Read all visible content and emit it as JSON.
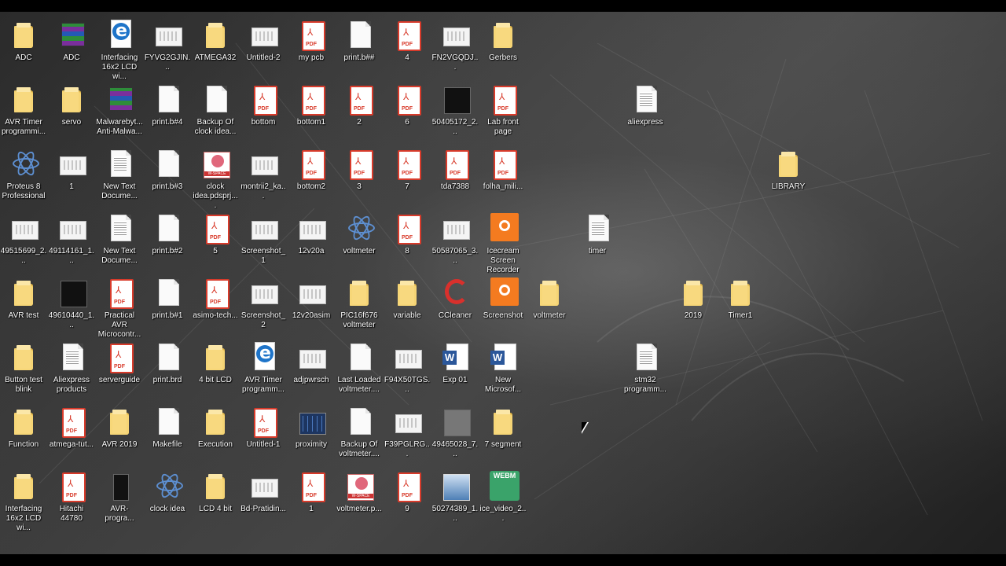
{
  "window": {
    "title": "Desktop"
  },
  "icons": [
    {
      "label": "ADC",
      "type": "folder"
    },
    {
      "label": "ADC",
      "type": "winrar"
    },
    {
      "label": "Interfacing 16x2 LCD wi...",
      "type": "edge"
    },
    {
      "label": "FYVG2GJIN...",
      "type": "image"
    },
    {
      "label": "ATMEGA32",
      "type": "folder"
    },
    {
      "label": "Untitled-2",
      "type": "image"
    },
    {
      "label": "my pcb",
      "type": "pdf"
    },
    {
      "label": "print.b##",
      "type": "document"
    },
    {
      "label": "4",
      "type": "pdf"
    },
    {
      "label": "FN2VGQDJ...",
      "type": "image"
    },
    {
      "label": "Gerbers",
      "type": "folder"
    },
    {
      "label": "AVR Timer programmi...",
      "type": "folder"
    },
    {
      "label": "servo",
      "type": "folder"
    },
    {
      "label": "Malwarebyt... Anti-Malwa...",
      "type": "winrar"
    },
    {
      "label": "print.b#4",
      "type": "document"
    },
    {
      "label": "Backup Of clock idea...",
      "type": "document"
    },
    {
      "label": "bottom",
      "type": "pdf"
    },
    {
      "label": "bottom1",
      "type": "pdf"
    },
    {
      "label": "2",
      "type": "pdf"
    },
    {
      "label": "6",
      "type": "pdf"
    },
    {
      "label": "50405172_2...",
      "type": "dark"
    },
    {
      "label": "Lab front page",
      "type": "pdf"
    },
    {
      "label": "aliexpress",
      "type": "text"
    },
    {
      "label": "Proteus 8 Professional",
      "type": "proteus"
    },
    {
      "label": "1",
      "type": "image"
    },
    {
      "label": "New Text Docume...",
      "type": "text"
    },
    {
      "label": "print.b#3",
      "type": "document"
    },
    {
      "label": "clock idea.pdsprj....",
      "type": "wspace"
    },
    {
      "label": "montrii2_ka...",
      "type": "image"
    },
    {
      "label": "bottom2",
      "type": "pdf"
    },
    {
      "label": "3",
      "type": "pdf"
    },
    {
      "label": "7",
      "type": "pdf"
    },
    {
      "label": "tda7388",
      "type": "pdf"
    },
    {
      "label": "folha_mili...",
      "type": "pdf"
    },
    {
      "label": "LIBRARY",
      "type": "folder"
    },
    {
      "label": "49515699_2...",
      "type": "image"
    },
    {
      "label": "49114161_1...",
      "type": "image"
    },
    {
      "label": "New Text Docume...",
      "type": "text"
    },
    {
      "label": "print.b#2",
      "type": "document"
    },
    {
      "label": "5",
      "type": "pdf"
    },
    {
      "label": "Screenshot_1",
      "type": "image"
    },
    {
      "label": "12v20a",
      "type": "image"
    },
    {
      "label": "voltmeter",
      "type": "proteus"
    },
    {
      "label": "8",
      "type": "pdf"
    },
    {
      "label": "50587065_3...",
      "type": "image"
    },
    {
      "label": "Icecream Screen Recorder",
      "type": "orange"
    },
    {
      "label": "timer",
      "type": "text"
    },
    {
      "label": "AVR test",
      "type": "folder"
    },
    {
      "label": "49610440_1...",
      "type": "dark"
    },
    {
      "label": "Practical AVR Microcontr...",
      "type": "pdf"
    },
    {
      "label": "print.b#1",
      "type": "document"
    },
    {
      "label": "asimo-tech...",
      "type": "pdf"
    },
    {
      "label": "Screenshot_2",
      "type": "image"
    },
    {
      "label": "12v20asim",
      "type": "image"
    },
    {
      "label": "PIC16f676 voltmeter",
      "type": "folder"
    },
    {
      "label": "variable",
      "type": "folder"
    },
    {
      "label": "CCleaner",
      "type": "ccleaner"
    },
    {
      "label": "Screenshot",
      "type": "orange"
    },
    {
      "label": "voltmeter",
      "type": "folder"
    },
    {
      "label": "2019",
      "type": "folder"
    },
    {
      "label": "Timer1",
      "type": "folder"
    },
    {
      "label": "Button test blink",
      "type": "folder"
    },
    {
      "label": "Aliexpress products",
      "type": "text"
    },
    {
      "label": "serverguide",
      "type": "pdf"
    },
    {
      "label": "print.brd",
      "type": "document"
    },
    {
      "label": "4 bit LCD",
      "type": "folder"
    },
    {
      "label": "AVR Timer programm...",
      "type": "edge"
    },
    {
      "label": "adjpwrsch",
      "type": "image"
    },
    {
      "label": "Last Loaded voltmeter....",
      "type": "document"
    },
    {
      "label": "F94X50TGS...",
      "type": "image"
    },
    {
      "label": "Exp 01",
      "type": "word"
    },
    {
      "label": "New Microsof...",
      "type": "word"
    },
    {
      "label": "stm32 programm...",
      "type": "text"
    },
    {
      "label": "Function",
      "type": "folder"
    },
    {
      "label": "atmega-tut...",
      "type": "pdf"
    },
    {
      "label": "AVR 2019",
      "type": "folder"
    },
    {
      "label": "Makefile",
      "type": "document"
    },
    {
      "label": "Execution",
      "type": "folder"
    },
    {
      "label": "Untitled-1",
      "type": "pdf"
    },
    {
      "label": "proximity",
      "type": "pcb"
    },
    {
      "label": "Backup Of voltmeter....",
      "type": "document"
    },
    {
      "label": "F39PGLRG...",
      "type": "image"
    },
    {
      "label": "49465028_7...",
      "type": "dark"
    },
    {
      "label": "7 segment",
      "type": "folder"
    },
    {
      "label": "Interfacing 16x2 LCD wi...",
      "type": "folder"
    },
    {
      "label": "Hitachi 44780",
      "type": "pdf"
    },
    {
      "label": "AVR-progra...",
      "type": "dark"
    },
    {
      "label": "clock idea",
      "type": "proteus"
    },
    {
      "label": "LCD 4 bit",
      "type": "folder"
    },
    {
      "label": "Bd-Pratidin...",
      "type": "image"
    },
    {
      "label": "1",
      "type": "pdf"
    },
    {
      "label": "voltmeter.p...",
      "type": "wspace"
    },
    {
      "label": "9",
      "type": "pdf"
    },
    {
      "label": "50274389_1...",
      "type": "photo"
    },
    {
      "label": "ice_video_2...",
      "type": "webm",
      "badge": "WEBM"
    }
  ]
}
